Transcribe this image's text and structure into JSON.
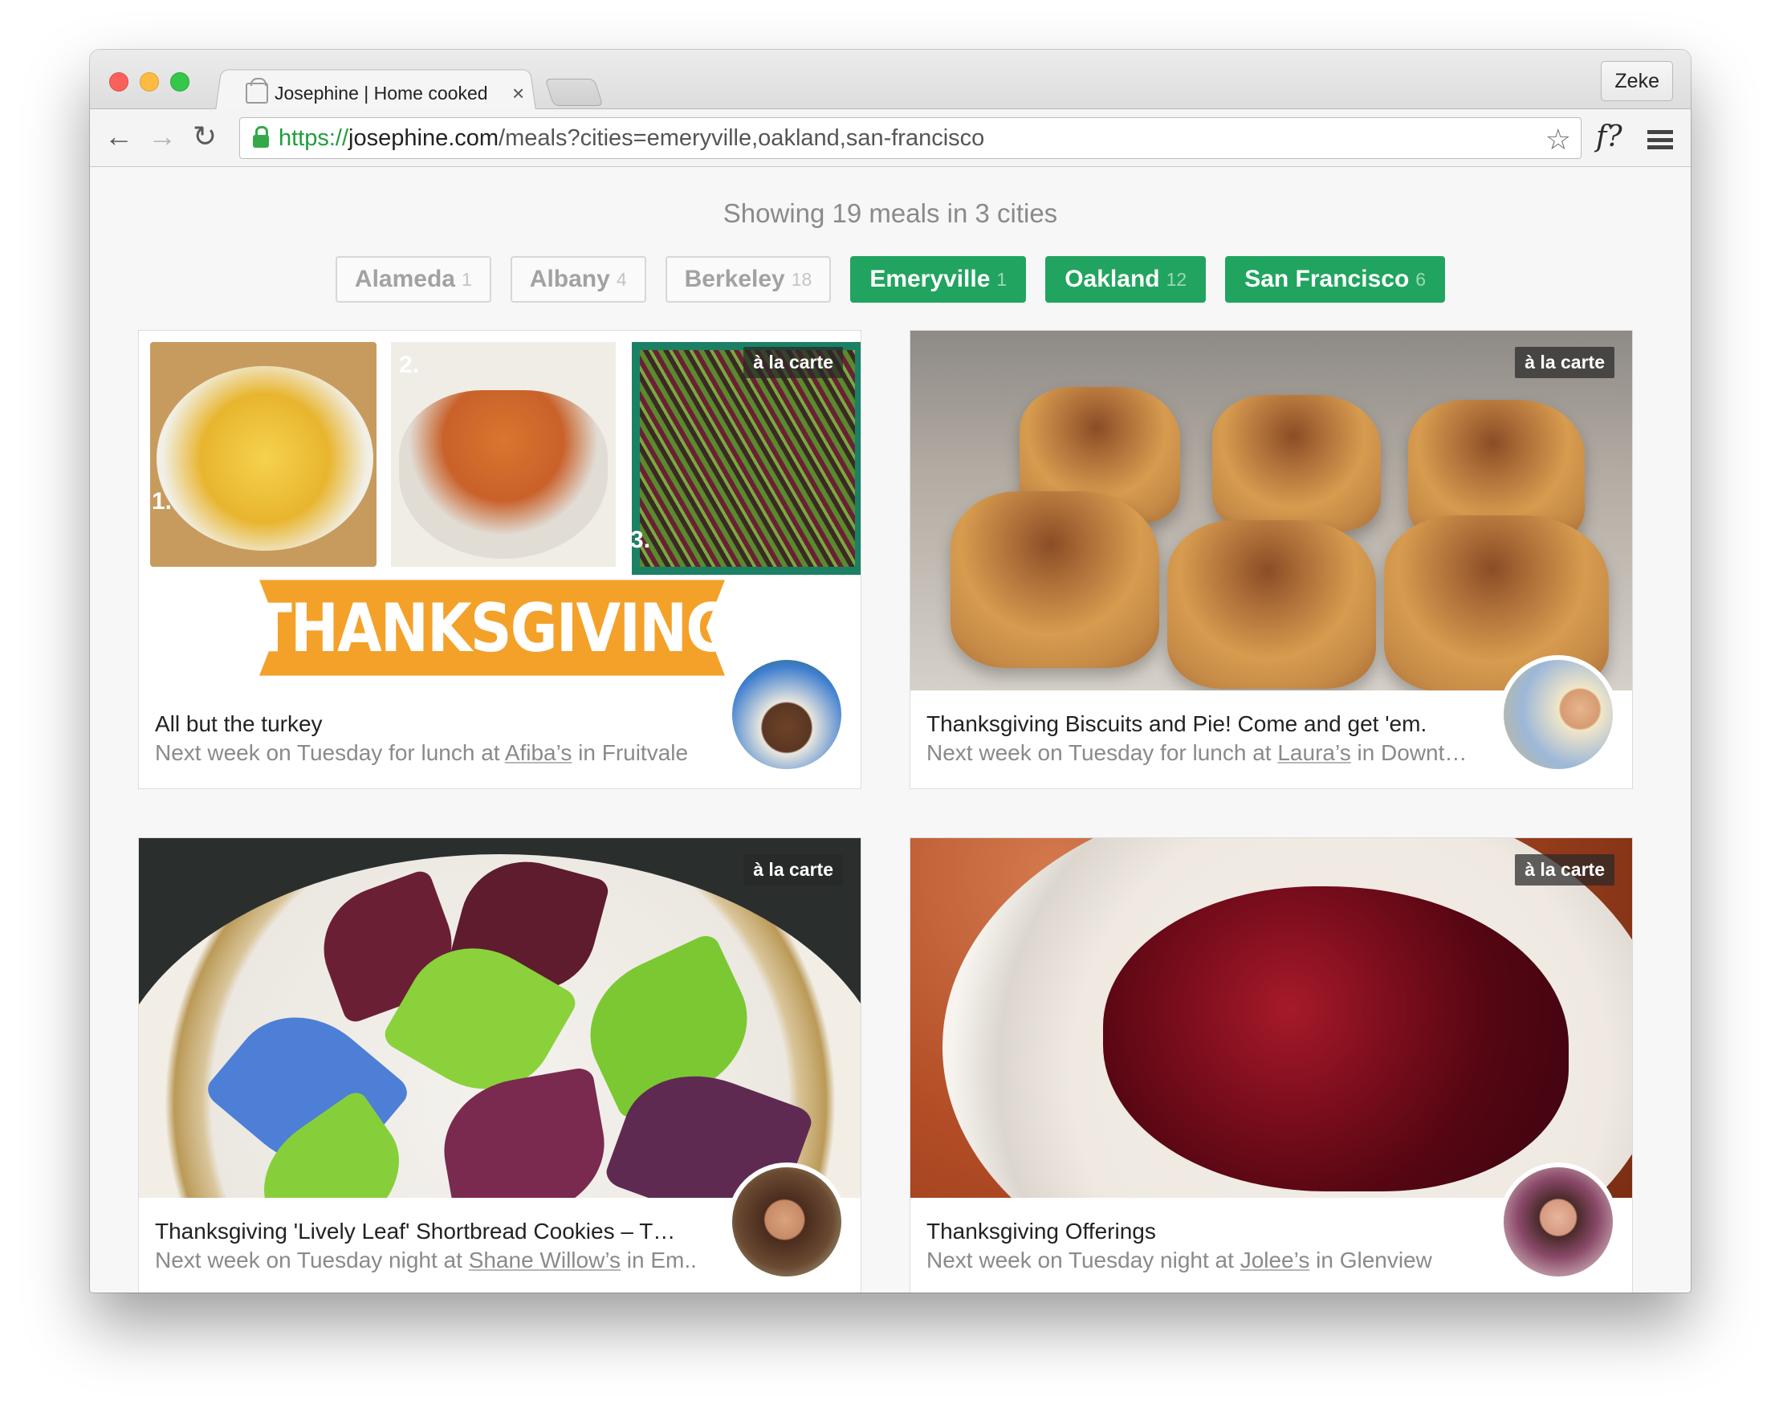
{
  "browser": {
    "tab_title": "Josephine | Home cooked",
    "tab_close": "×",
    "profile_name": "Zeke",
    "url_scheme": "https://",
    "url_host": "josephine.com",
    "url_path": "/meals?cities=emeryville,oakland,san-francisco",
    "icons": {
      "back": "←",
      "forward": "→",
      "reload": "↻",
      "star": "☆",
      "extension": "f?"
    }
  },
  "page": {
    "showing_text": "Showing 19 meals in 3 cities",
    "accent_color": "#21a45f",
    "cities": [
      {
        "name": "Alameda",
        "count": "1",
        "selected": false
      },
      {
        "name": "Albany",
        "count": "4",
        "selected": false
      },
      {
        "name": "Berkeley",
        "count": "18",
        "selected": false
      },
      {
        "name": "Emeryville",
        "count": "1",
        "selected": true
      },
      {
        "name": "Oakland",
        "count": "12",
        "selected": true
      },
      {
        "name": "San Francisco",
        "count": "6",
        "selected": true
      }
    ],
    "meals": [
      {
        "badge": "à la carte",
        "title": "All but the turkey",
        "sub_prefix": "Next week on Tuesday for lunch at ",
        "host": "Afiba’s",
        "sub_suffix": " in Fruitvale",
        "photo_text": "THANKSGIVING",
        "photo_nums": [
          "1.",
          "2.",
          "3."
        ]
      },
      {
        "badge": "à la carte",
        "title": "Thanksgiving Biscuits and Pie! Come and get 'em.",
        "sub_prefix": "Next week on Tuesday for lunch at ",
        "host": "Laura’s",
        "sub_suffix": " in Downt…"
      },
      {
        "badge": "à la carte",
        "title": "Thanksgiving 'Lively Leaf' Shortbread Cookies – T…",
        "sub_prefix": "Next week on Tuesday night at ",
        "host": "Shane Willow’s",
        "sub_suffix": " in Em.."
      },
      {
        "badge": "à la carte",
        "title": "Thanksgiving Offerings",
        "sub_prefix": "Next week on Tuesday night at ",
        "host": "Jolee’s",
        "sub_suffix": " in Glenview"
      }
    ]
  }
}
